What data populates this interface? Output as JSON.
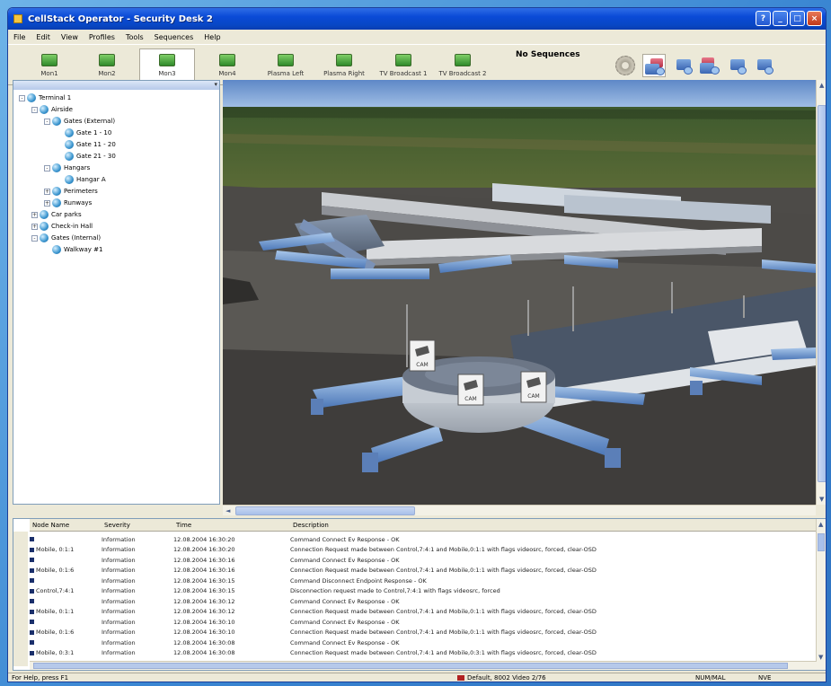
{
  "window": {
    "title": "CellStack Operator - Security Desk 2",
    "controls": [
      "help",
      "minimize",
      "maximize",
      "close"
    ]
  },
  "menu": [
    "File",
    "Edit",
    "View",
    "Profiles",
    "Tools",
    "Sequences",
    "Help"
  ],
  "toolbar": {
    "buttons": [
      {
        "label": "Mon1"
      },
      {
        "label": "Mon2"
      },
      {
        "label": "Mon3",
        "selected": true
      },
      {
        "label": "Mon4"
      },
      {
        "label": "Plasma Left"
      },
      {
        "label": "Plasma Right"
      },
      {
        "label": "TV Broadcast 1"
      },
      {
        "label": "TV Broadcast 2"
      }
    ],
    "sequence_status": "No Sequences",
    "camera_tools": [
      "settings-gear-icon",
      "camera-tool-1-icon",
      "camera-tool-2-icon",
      "camera-tool-3-icon",
      "camera-tool-4-icon",
      "camera-tool-5-icon"
    ]
  },
  "tree": [
    {
      "label": "Terminal 1",
      "depth": 0,
      "expander": "-"
    },
    {
      "label": "Airside",
      "depth": 1,
      "expander": "-"
    },
    {
      "label": "Gates (External)",
      "depth": 2,
      "expander": "-"
    },
    {
      "label": "Gate 1 - 10",
      "depth": 3,
      "expander": ""
    },
    {
      "label": "Gate 11 - 20",
      "depth": 3,
      "expander": ""
    },
    {
      "label": "Gate 21 - 30",
      "depth": 3,
      "expander": ""
    },
    {
      "label": "Hangars",
      "depth": 2,
      "expander": "-"
    },
    {
      "label": "Hangar A",
      "depth": 3,
      "expander": ""
    },
    {
      "label": "Perimeters",
      "depth": 2,
      "expander": "+"
    },
    {
      "label": "Runways",
      "depth": 2,
      "expander": "+"
    },
    {
      "label": "Car parks",
      "depth": 1,
      "expander": "+"
    },
    {
      "label": "Check-in Hall",
      "depth": 1,
      "expander": "+"
    },
    {
      "label": "Gates (Internal)",
      "depth": 1,
      "expander": "-"
    },
    {
      "label": "Walkway #1",
      "depth": 2,
      "expander": ""
    }
  ],
  "view_cameras": [
    {
      "label": "CAM"
    },
    {
      "label": "CAM"
    },
    {
      "label": "CAM"
    }
  ],
  "log": {
    "columns": [
      "Node Name",
      "Severity",
      "Time",
      "Description"
    ],
    "rows": [
      {
        "node": "",
        "severity": "Information",
        "time": "12.08.2004 16:30:20",
        "desc": "Command Connect Ev Response - OK"
      },
      {
        "node": "Mobile, 0:1:1",
        "severity": "Information",
        "time": "12.08.2004 16:30:20",
        "desc": "Connection Request made between Control,7:4:1 and Mobile,0:1:1 with flags videosrc, forced, clear-OSD"
      },
      {
        "node": "",
        "severity": "Information",
        "time": "12.08.2004 16:30:16",
        "desc": "Command Connect Ev Response - OK"
      },
      {
        "node": "Mobile, 0:1:6",
        "severity": "Information",
        "time": "12.08.2004 16:30:16",
        "desc": "Connection Request made between Control,7:4:1 and Mobile,0:1:1 with flags videosrc, forced, clear-OSD"
      },
      {
        "node": "",
        "severity": "Information",
        "time": "12.08.2004 16:30:15",
        "desc": "Command Disconnect Endpoint Response - OK"
      },
      {
        "node": "Control,7:4:1",
        "severity": "Information",
        "time": "12.08.2004 16:30:15",
        "desc": "Disconnection request made to Control,7:4:1 with flags videosrc, forced"
      },
      {
        "node": "",
        "severity": "Information",
        "time": "12.08.2004 16:30:12",
        "desc": "Command Connect Ev Response - OK"
      },
      {
        "node": "Mobile, 0:1:1",
        "severity": "Information",
        "time": "12.08.2004 16:30:12",
        "desc": "Connection Request made between Control,7:4:1 and Mobile,0:1:1 with flags videosrc, forced, clear-OSD"
      },
      {
        "node": "",
        "severity": "Information",
        "time": "12.08.2004 16:30:10",
        "desc": "Command Connect Ev Response - OK"
      },
      {
        "node": "Mobile, 0:1:6",
        "severity": "Information",
        "time": "12.08.2004 16:30:10",
        "desc": "Connection Request made between Control,7:4:1 and Mobile,0:1:1 with flags videosrc, forced, clear-OSD"
      },
      {
        "node": "",
        "severity": "Information",
        "time": "12.08.2004 16:30:08",
        "desc": "Command Connect Ev Response - OK"
      },
      {
        "node": "Mobile, 0:3:1",
        "severity": "Information",
        "time": "12.08.2004 16:30:08",
        "desc": "Connection Request made between Control,7:4:1 and Mobile,0:3:1 with flags videosrc, forced, clear-OSD"
      }
    ]
  },
  "status": {
    "help": "For Help, press F1",
    "connection": "Default, 8002 Video 2/76",
    "mode": "NUM/MAL",
    "extra": "NVE"
  }
}
